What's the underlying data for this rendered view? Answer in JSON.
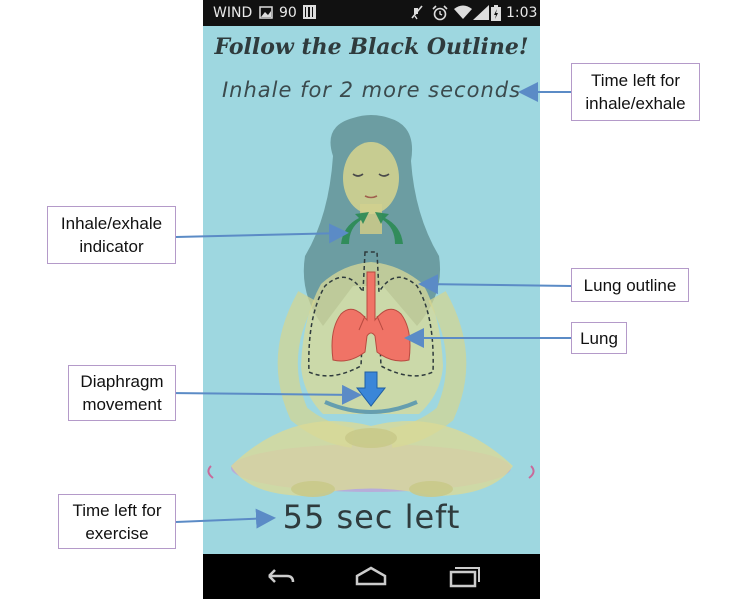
{
  "status_bar": {
    "carrier": "WIND",
    "battery_level": "90",
    "time": "1:03",
    "icons": [
      "image-icon",
      "barcode-icon",
      "mute-icon",
      "alarm-icon",
      "wifi-icon",
      "signal-icon",
      "battery-icon"
    ]
  },
  "app": {
    "title": "Follow the Black Outline!",
    "instruction": "Inhale for 2 more seconds",
    "time_left": "55 sec left"
  },
  "callouts": {
    "time_inhale_exhale_line1": "Time left for",
    "time_inhale_exhale_line2": "inhale/exhale",
    "indicator_line1": "Inhale/exhale",
    "indicator_line2": "indicator",
    "lung_outline": "Lung outline",
    "lung": "Lung",
    "diaphragm_line1": "Diaphragm",
    "diaphragm_line2": "movement",
    "exercise_line1": "Time left for",
    "exercise_line2": "exercise"
  },
  "nav_bar": {
    "icons": [
      "back-icon",
      "home-icon",
      "recents-icon"
    ]
  },
  "colors": {
    "screen_background": "#9ed7e0",
    "lung": "#f07366",
    "diaphragm_arrow": "#3a86d8",
    "indicator_arrow": "#2e8b57",
    "callout_border": "#b49ac9",
    "callout_arrow": "#5b8bc6"
  }
}
